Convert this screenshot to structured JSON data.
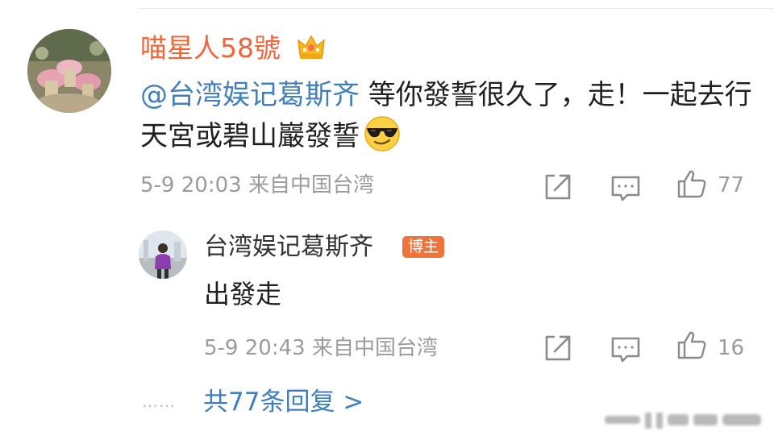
{
  "comment": {
    "username": "喵星人58號",
    "user_badge_icon": "crown-icon",
    "mention": "@台湾娱记葛斯齐",
    "text_part1": " 等你發誓很久了，走！一起去行天宮或碧山巖發誓",
    "emoji": "cool-sunglasses-emoji",
    "time": "5-9 20:03",
    "source": "来自中国台湾",
    "likes": "77"
  },
  "reply": {
    "username": "台湾娱记葛斯齐",
    "badge": "博主",
    "text": "出發走",
    "time": "5-9 20:43",
    "source": "来自中国台湾",
    "likes": "16"
  },
  "footer": {
    "dots": "……",
    "more_replies": "共77条回复 >"
  },
  "colors": {
    "username": "#f0653a",
    "link": "#3f7fbe",
    "meta": "#9b9b9b",
    "badge": "#f0733a"
  }
}
